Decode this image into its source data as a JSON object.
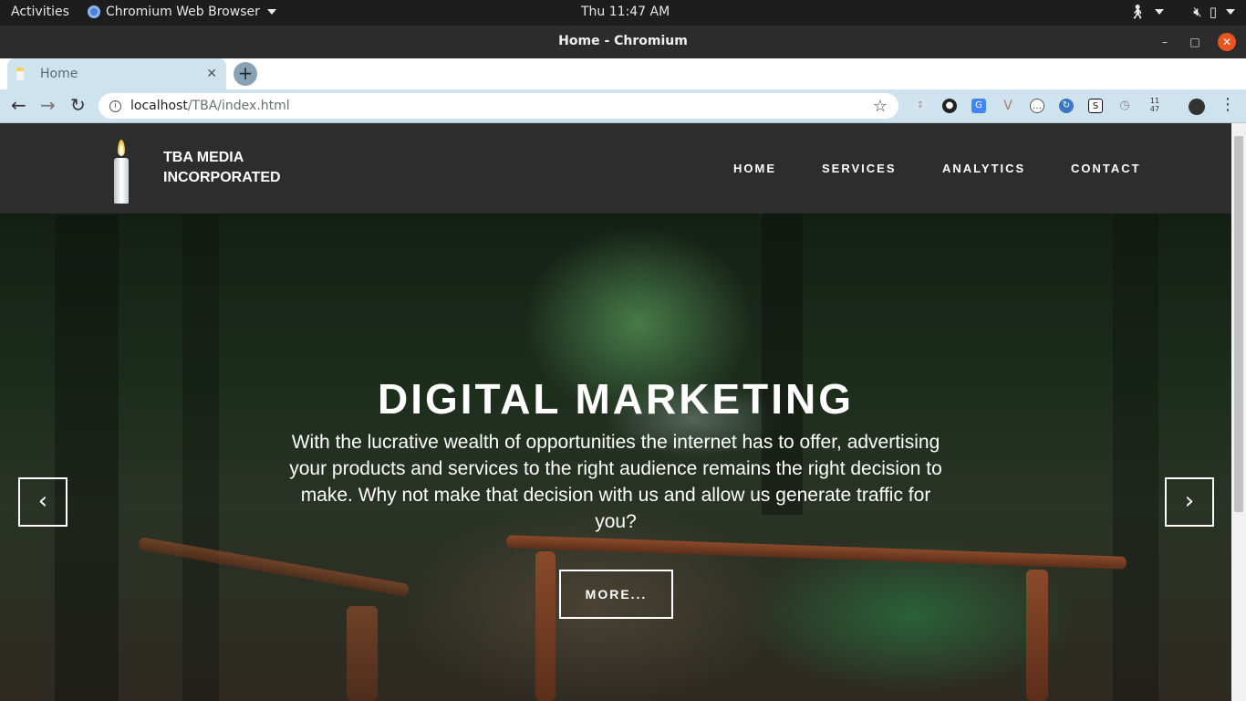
{
  "os": {
    "activities": "Activities",
    "app_name": "Chromium Web Browser",
    "clock": "Thu 11:47 AM"
  },
  "window": {
    "title": "Home - Chromium"
  },
  "browser": {
    "tab_title": "Home",
    "url_host": "localhost",
    "url_path": "/TBA/index.html",
    "extension_badge": "11 47"
  },
  "site": {
    "brand_line1": "TBA MEDIA",
    "brand_line2": "INCORPORATED",
    "nav": [
      "HOME",
      "SERVICES",
      "ANALYTICS",
      "CONTACT"
    ]
  },
  "hero": {
    "title": "DIGITAL MARKETING",
    "text": "With the lucrative wealth of opportunities the internet has to offer, advertising your products and services to the right audience remains the right decision to make. Why not make that decision with us and allow us generate traffic for you?",
    "button": "MORE..."
  },
  "colors": {
    "header_bg": "#2d2d2d",
    "close_button": "#e95420",
    "toolbar_bg": "#cfe3ef"
  }
}
